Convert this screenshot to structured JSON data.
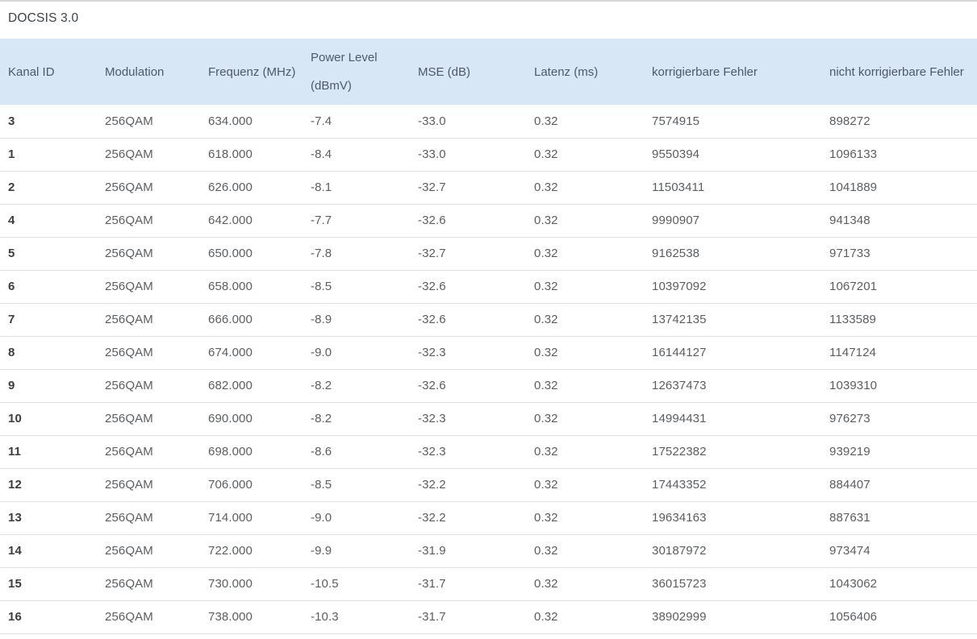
{
  "title": "DOCSIS 3.0",
  "colors": {
    "header_bg": "#d7e7f6",
    "header_text": "#4d5966",
    "body_text": "#5a5d60",
    "row_id_text": "#3b3e41",
    "title_text": "#3e4245",
    "divider": "#e0e0e0",
    "top_divider": "#d6d6d6"
  },
  "table": {
    "columns": [
      {
        "key": "kanal-id",
        "label": "Kanal ID"
      },
      {
        "key": "modulation",
        "label": "Modulation"
      },
      {
        "key": "frequenz",
        "label": "Frequenz (MHz)"
      },
      {
        "key": "power-level",
        "label": "Power Level (dBmV)"
      },
      {
        "key": "mse",
        "label": "MSE (dB)"
      },
      {
        "key": "latenz",
        "label": "Latenz (ms)"
      },
      {
        "key": "korrigierbare-fehler",
        "label": "korrigierbare Fehler"
      },
      {
        "key": "nicht-korrigierbare-fehler",
        "label": "nicht korrigierbare Fehler"
      }
    ],
    "rows": [
      [
        "3",
        "256QAM",
        "634.000",
        "-7.4",
        "-33.0",
        "0.32",
        "7574915",
        "898272"
      ],
      [
        "1",
        "256QAM",
        "618.000",
        "-8.4",
        "-33.0",
        "0.32",
        "9550394",
        "1096133"
      ],
      [
        "2",
        "256QAM",
        "626.000",
        "-8.1",
        "-32.7",
        "0.32",
        "11503411",
        "1041889"
      ],
      [
        "4",
        "256QAM",
        "642.000",
        "-7.7",
        "-32.6",
        "0.32",
        "9990907",
        "941348"
      ],
      [
        "5",
        "256QAM",
        "650.000",
        "-7.8",
        "-32.7",
        "0.32",
        "9162538",
        "971733"
      ],
      [
        "6",
        "256QAM",
        "658.000",
        "-8.5",
        "-32.6",
        "0.32",
        "10397092",
        "1067201"
      ],
      [
        "7",
        "256QAM",
        "666.000",
        "-8.9",
        "-32.6",
        "0.32",
        "13742135",
        "1133589"
      ],
      [
        "8",
        "256QAM",
        "674.000",
        "-9.0",
        "-32.3",
        "0.32",
        "16144127",
        "1147124"
      ],
      [
        "9",
        "256QAM",
        "682.000",
        "-8.2",
        "-32.6",
        "0.32",
        "12637473",
        "1039310"
      ],
      [
        "10",
        "256QAM",
        "690.000",
        "-8.2",
        "-32.3",
        "0.32",
        "14994431",
        "976273"
      ],
      [
        "11",
        "256QAM",
        "698.000",
        "-8.6",
        "-32.3",
        "0.32",
        "17522382",
        "939219"
      ],
      [
        "12",
        "256QAM",
        "706.000",
        "-8.5",
        "-32.2",
        "0.32",
        "17443352",
        "884407"
      ],
      [
        "13",
        "256QAM",
        "714.000",
        "-9.0",
        "-32.2",
        "0.32",
        "19634163",
        "887631"
      ],
      [
        "14",
        "256QAM",
        "722.000",
        "-9.9",
        "-31.9",
        "0.32",
        "30187972",
        "973474"
      ],
      [
        "15",
        "256QAM",
        "730.000",
        "-10.5",
        "-31.7",
        "0.32",
        "36015723",
        "1043062"
      ],
      [
        "16",
        "256QAM",
        "738.000",
        "-10.3",
        "-31.7",
        "0.32",
        "38902999",
        "1056406"
      ]
    ]
  }
}
